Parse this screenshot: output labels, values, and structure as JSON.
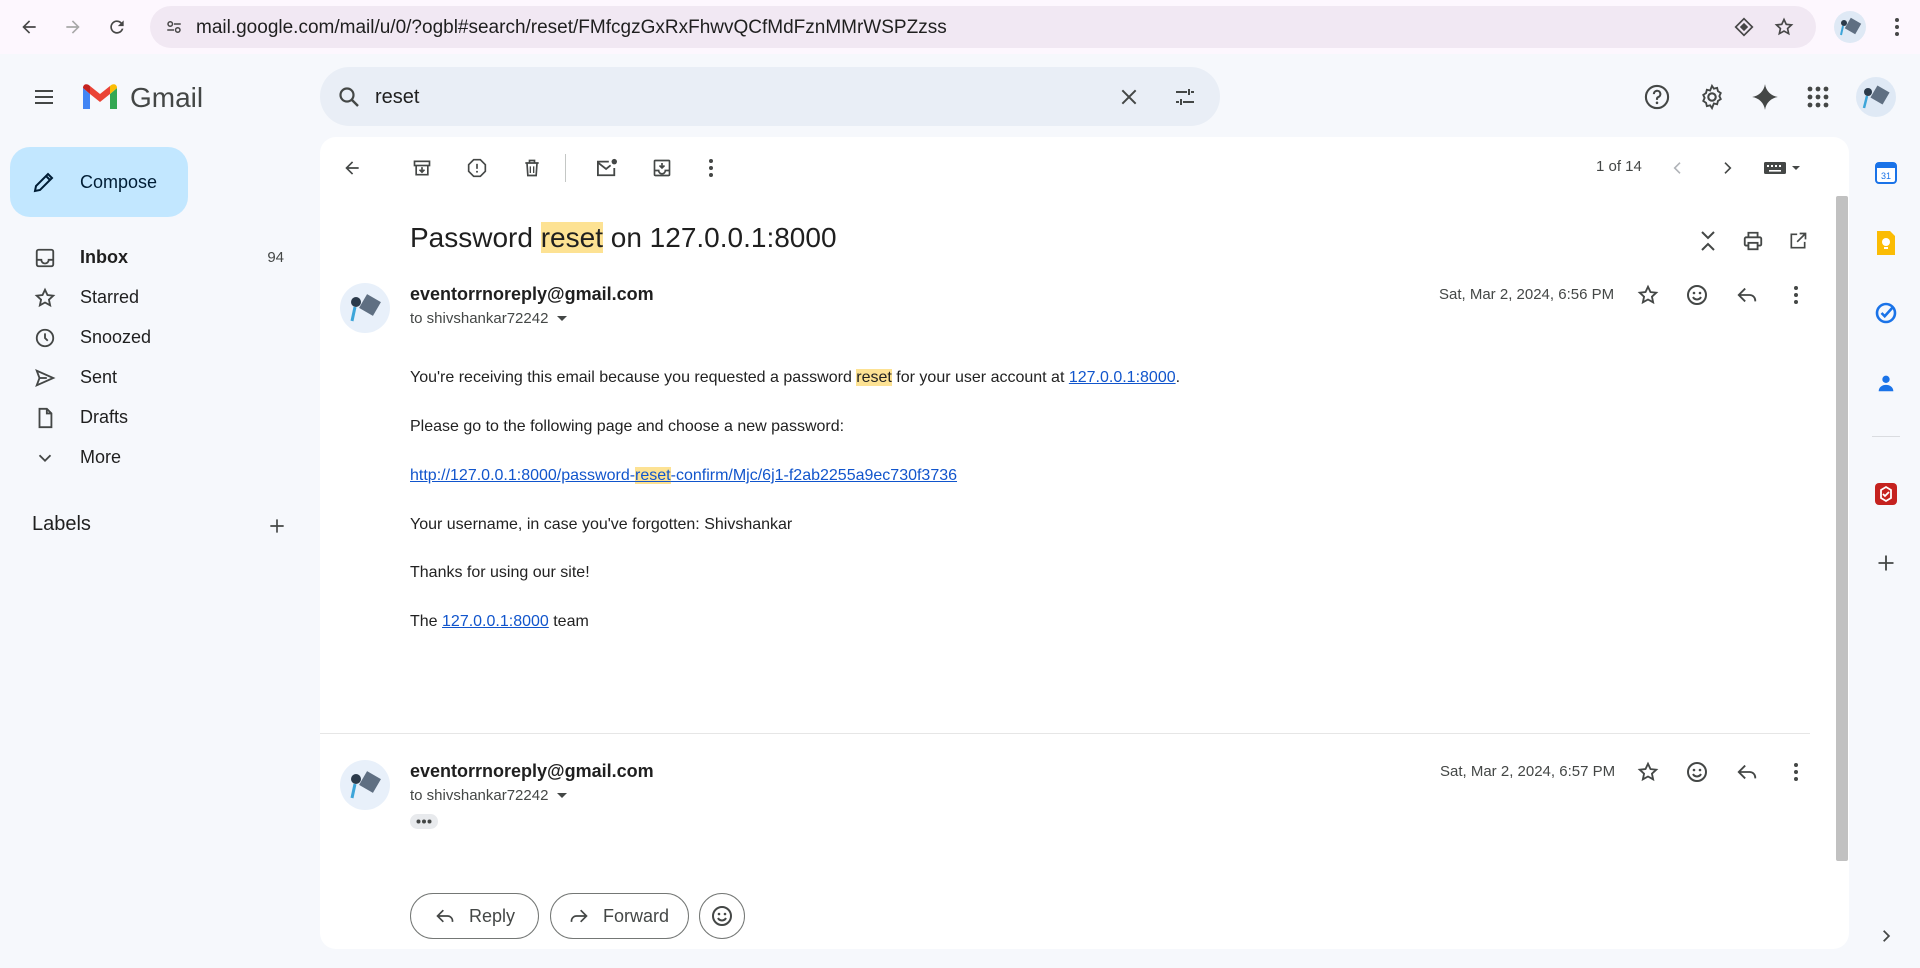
{
  "browser": {
    "url": "mail.google.com/mail/u/0/?ogbl#search/reset/FMfcgzGxRxFhwvQCfMdFznMMrWSPZzss"
  },
  "header": {
    "app_name": "Gmail",
    "search_query": "reset"
  },
  "sidebar": {
    "compose_label": "Compose",
    "items": [
      {
        "label": "Inbox",
        "count": "94"
      },
      {
        "label": "Starred",
        "count": ""
      },
      {
        "label": "Snoozed",
        "count": ""
      },
      {
        "label": "Sent",
        "count": ""
      },
      {
        "label": "Drafts",
        "count": ""
      },
      {
        "label": "More",
        "count": ""
      }
    ],
    "labels_heading": "Labels"
  },
  "toolbar": {
    "pagination": "1 of 14"
  },
  "thread": {
    "subject_before": "Password ",
    "subject_highlight": "reset",
    "subject_after": " on 127.0.0.1:8000",
    "messages": [
      {
        "sender": "eventorrnoreply@gmail.com",
        "to": "to shivshankar72242",
        "date": "Sat, Mar 2, 2024, 6:56 PM"
      },
      {
        "sender": "eventorrnoreply@gmail.com",
        "to": "to shivshankar72242",
        "date": "Sat, Mar 2, 2024, 6:57 PM"
      }
    ],
    "body": {
      "p1_a": "You're receiving this email because you requested a password ",
      "p1_hl": "reset",
      "p1_b": " for your user account at ",
      "p1_link": "127.0.0.1:8000",
      "p1_c": ".",
      "p2": "Please go to the following page and choose a new password:",
      "link_a": "http://127.0.0.1:8000/password-",
      "link_hl": "reset",
      "link_b": "-confirm/Mjc/6j1-f2ab2255a9ec730f3736",
      "p3": "Your username, in case you've forgotten: Shivshankar",
      "p4": "Thanks for using our site!",
      "p5_a": "The ",
      "p5_link": "127.0.0.1:8000",
      "p5_b": " team"
    },
    "reply_label": "Reply",
    "forward_label": "Forward"
  },
  "colors": {
    "compose_bg": "#c2e7ff",
    "highlight": "#fde293",
    "link": "#1155cc",
    "app_bg": "#f6f8fc"
  }
}
